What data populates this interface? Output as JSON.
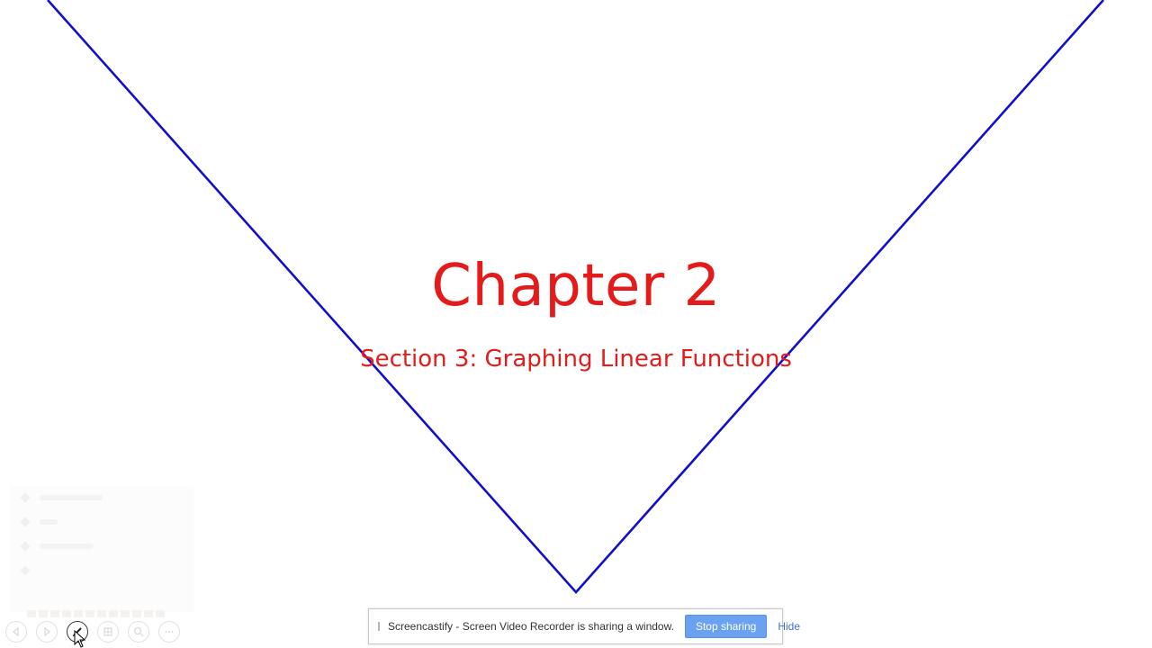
{
  "slide": {
    "title": "Chapter 2",
    "subtitle": "Section 3: Graphing Linear Functions",
    "text_color": "#e31b1b",
    "line_color": "#1111cc"
  },
  "slideshow_controls": {
    "buttons": [
      {
        "icon": "previous-icon"
      },
      {
        "icon": "next-icon"
      },
      {
        "icon": "pen-icon",
        "active": true
      },
      {
        "icon": "slides-grid-icon"
      },
      {
        "icon": "zoom-icon"
      },
      {
        "icon": "more-icon"
      }
    ]
  },
  "share_bar": {
    "message": "Screencastify - Screen Video Recorder is sharing a window.",
    "stop_label": "Stop sharing",
    "hide_label": "Hide",
    "accent": "#6aa1f0"
  }
}
